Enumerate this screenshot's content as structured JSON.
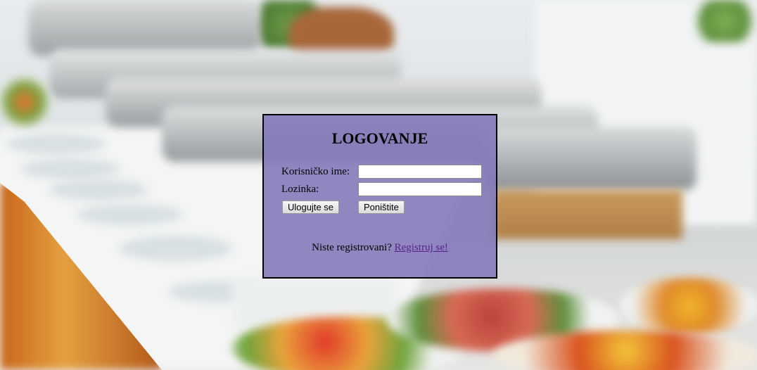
{
  "login": {
    "title": "LOGOVANJE",
    "username_label": "Korisničko ime:",
    "username_value": "",
    "password_label": "Lozinka:",
    "password_value": "",
    "login_button": "Ulogujte se",
    "reset_button": "Poništite",
    "register_prompt": "Niste registrovani?",
    "register_link": "Registruj se!"
  },
  "colors": {
    "panel_background": "#8278b9",
    "panel_border": "#000000",
    "link": "#5a1f8a"
  }
}
